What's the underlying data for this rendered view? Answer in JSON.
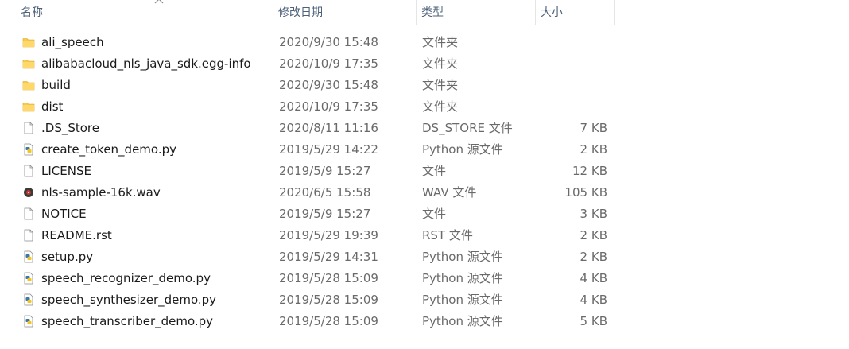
{
  "columns": {
    "name": "名称",
    "date": "修改日期",
    "type": "类型",
    "size": "大小"
  },
  "files": [
    {
      "name": "ali_speech",
      "date": "2020/9/30 15:48",
      "type": "文件夹",
      "size": "",
      "icon": "folder"
    },
    {
      "name": "alibabacloud_nls_java_sdk.egg-info",
      "date": "2020/10/9 17:35",
      "type": "文件夹",
      "size": "",
      "icon": "folder"
    },
    {
      "name": "build",
      "date": "2020/9/30 15:48",
      "type": "文件夹",
      "size": "",
      "icon": "folder"
    },
    {
      "name": "dist",
      "date": "2020/10/9 17:35",
      "type": "文件夹",
      "size": "",
      "icon": "folder"
    },
    {
      "name": ".DS_Store",
      "date": "2020/8/11 11:16",
      "type": "DS_STORE 文件",
      "size": "7 KB",
      "icon": "file"
    },
    {
      "name": "create_token_demo.py",
      "date": "2019/5/29 14:22",
      "type": "Python 源文件",
      "size": "2 KB",
      "icon": "python"
    },
    {
      "name": "LICENSE",
      "date": "2019/5/9 15:27",
      "type": "文件",
      "size": "12 KB",
      "icon": "file"
    },
    {
      "name": "nls-sample-16k.wav",
      "date": "2020/6/5 15:58",
      "type": "WAV 文件",
      "size": "105 KB",
      "icon": "audio"
    },
    {
      "name": "NOTICE",
      "date": "2019/5/9 15:27",
      "type": "文件",
      "size": "3 KB",
      "icon": "file"
    },
    {
      "name": "README.rst",
      "date": "2019/5/29 19:39",
      "type": "RST 文件",
      "size": "2 KB",
      "icon": "file"
    },
    {
      "name": "setup.py",
      "date": "2019/5/29 14:31",
      "type": "Python 源文件",
      "size": "2 KB",
      "icon": "python"
    },
    {
      "name": "speech_recognizer_demo.py",
      "date": "2019/5/28 15:09",
      "type": "Python 源文件",
      "size": "4 KB",
      "icon": "python"
    },
    {
      "name": "speech_synthesizer_demo.py",
      "date": "2019/5/28 15:09",
      "type": "Python 源文件",
      "size": "4 KB",
      "icon": "python"
    },
    {
      "name": "speech_transcriber_demo.py",
      "date": "2019/5/28 15:09",
      "type": "Python 源文件",
      "size": "5 KB",
      "icon": "python"
    }
  ],
  "colors": {
    "folder": "#f7c948",
    "python_blue": "#3b77a8",
    "python_yellow": "#f5c518",
    "header_text": "#4c607a"
  }
}
